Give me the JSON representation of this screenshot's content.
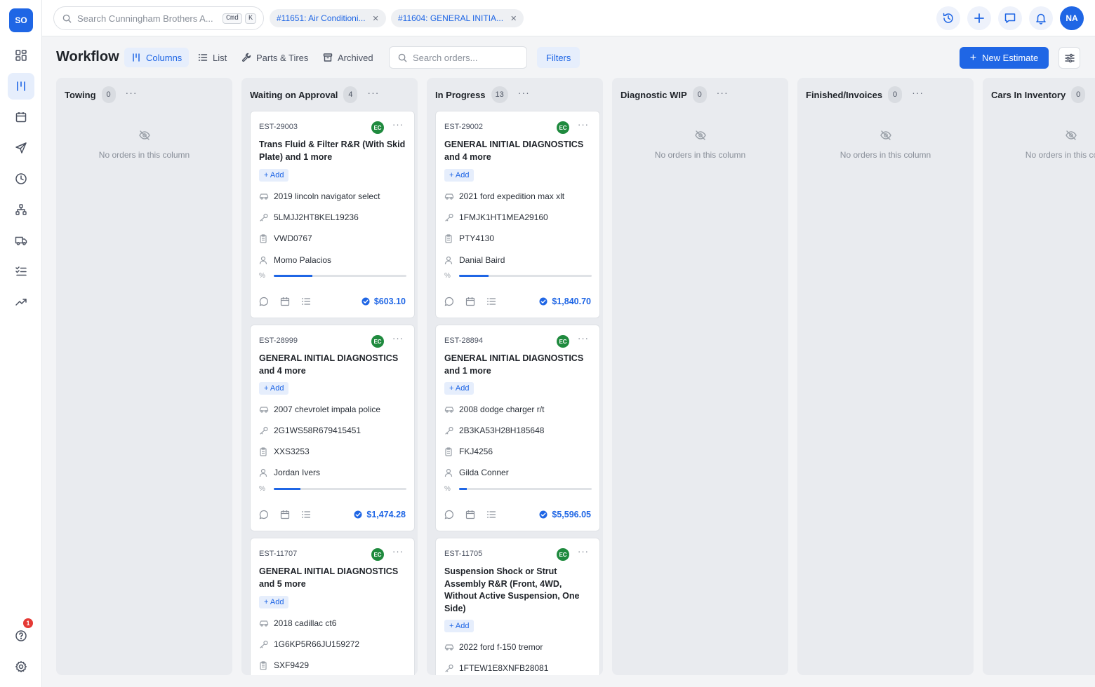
{
  "sidebar": {
    "logo": "SO",
    "items": [
      {
        "name": "dashboard",
        "icon": "grid-icon",
        "active": false
      },
      {
        "name": "workflow",
        "icon": "columns-icon",
        "active": true
      },
      {
        "name": "calendar",
        "icon": "calendar-icon",
        "active": false
      },
      {
        "name": "messages",
        "icon": "send-icon",
        "active": false
      },
      {
        "name": "time",
        "icon": "clock-icon",
        "active": false
      },
      {
        "name": "organization",
        "icon": "hierarchy-icon",
        "active": false
      },
      {
        "name": "fleet",
        "icon": "truck-icon",
        "active": false
      },
      {
        "name": "tasks",
        "icon": "checklist-icon",
        "active": false
      },
      {
        "name": "reports",
        "icon": "trending-up-icon",
        "active": false
      }
    ],
    "help_badge": "1"
  },
  "topbar": {
    "search_placeholder": "Search Cunningham Brothers A...",
    "kbd_cmd": "Cmd",
    "kbd_k": "K",
    "tabs": [
      {
        "label": "#11651: Air Conditioni..."
      },
      {
        "label": "#11604: GENERAL INITIA..."
      }
    ],
    "avatar": "NA"
  },
  "page": {
    "title": "Workflow",
    "view_tabs": [
      {
        "label": "Columns",
        "active": true
      },
      {
        "label": "List",
        "active": false
      },
      {
        "label": "Parts & Tires",
        "active": false
      },
      {
        "label": "Archived",
        "active": false
      }
    ],
    "search_placeholder": "Search orders...",
    "filters_label": "Filters",
    "new_estimate_label": "New Estimate"
  },
  "board": {
    "empty_text": "No orders in this column",
    "add_label": "+ Add",
    "columns": [
      {
        "title": "Towing",
        "count": "0",
        "cards": []
      },
      {
        "title": "Waiting on Approval",
        "count": "4",
        "cards": [
          {
            "est": "EST-29003",
            "tech": "EC",
            "title": "Trans Fluid & Filter R&R (With Skid Plate) and 1 more",
            "vehicle": "2019 lincoln navigator select",
            "vin": "5LMJJ2HT8KEL19236",
            "plate": "VWD0767",
            "customer": "Momo Palacios",
            "progress": 0.29,
            "amount": "$603.10"
          },
          {
            "est": "EST-28999",
            "tech": "EC",
            "title": "GENERAL INITIAL DIAGNOSTICS and 4 more",
            "vehicle": "2007 chevrolet impala police",
            "vin": "2G1WS58R679415451",
            "plate": "XXS3253",
            "customer": "Jordan Ivers",
            "progress": 0.2,
            "amount": "$1,474.28"
          },
          {
            "est": "EST-11707",
            "tech": "EC",
            "title": "GENERAL INITIAL DIAGNOSTICS and 5 more",
            "vehicle": "2018 cadillac ct6",
            "vin": "1G6KP5R66JU159272",
            "plate": "SXF9429",
            "customer": "",
            "progress": null,
            "amount": ""
          }
        ]
      },
      {
        "title": "In Progress",
        "count": "13",
        "cards": [
          {
            "est": "EST-29002",
            "tech": "EC",
            "title": "GENERAL INITIAL DIAGNOSTICS and 4 more",
            "vehicle": "2021 ford expedition max xlt",
            "vin": "1FMJK1HT1MEA29160",
            "plate": "PTY4130",
            "customer": "Danial Baird",
            "progress": 0.22,
            "amount": "$1,840.70"
          },
          {
            "est": "EST-28894",
            "tech": "EC",
            "title": "GENERAL INITIAL DIAGNOSTICS and 1 more",
            "vehicle": "2008 dodge charger r/t",
            "vin": "2B3KA53H28H185648",
            "plate": "FKJ4256",
            "customer": "Gilda Conner",
            "progress": 0.06,
            "amount": "$5,596.05"
          },
          {
            "est": "EST-11705",
            "tech": "EC",
            "title": "Suspension Shock or Strut Assembly R&R (Front, 4WD, Without Active Suspension, One Side)",
            "vehicle": "2022 ford f-150 tremor",
            "vin": "1FTEW1E8XNFB28081",
            "plate": "",
            "customer": "",
            "progress": null,
            "amount": ""
          }
        ]
      },
      {
        "title": "Diagnostic WIP",
        "count": "0",
        "cards": []
      },
      {
        "title": "Finished/Invoices",
        "count": "0",
        "cards": []
      },
      {
        "title": "Cars In Inventory",
        "count": "0",
        "cards": []
      }
    ]
  },
  "colors": {
    "accent": "#1f66e5",
    "tech_badge": "#1f8a3e",
    "column_bg": "#e9ebef"
  }
}
